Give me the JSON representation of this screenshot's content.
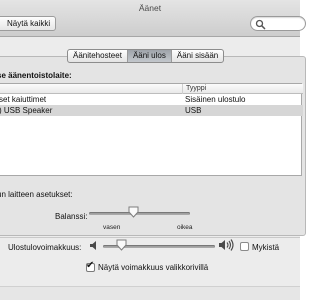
{
  "window": {
    "title": "Äänet"
  },
  "toolbar": {
    "show_all_label": "Näytä kaikki",
    "search_placeholder": ""
  },
  "tabs": [
    {
      "label": "Äänitehosteet",
      "active": false
    },
    {
      "label": "Ääni ulos",
      "active": true
    },
    {
      "label": "Ääni sisään",
      "active": false
    }
  ],
  "output": {
    "section_title": "se äänentoistolaite:",
    "table": {
      "columns": [
        "",
        "Tyyppi"
      ],
      "rows": [
        {
          "name": "set kaiuttimet",
          "type": "Sisäinen ulostulo",
          "selected": false
        },
        {
          "name": ") USB Speaker",
          "type": "USB",
          "selected": true
        }
      ]
    }
  },
  "device_settings": {
    "title": "un laitteen asetukset:",
    "balance_label": "Balanssi:",
    "balance_left": "vasen",
    "balance_right": "oikea",
    "balance_value": 0.5
  },
  "volume": {
    "label": "Ulostulovoimakkuus:",
    "level": 0.15,
    "mute_label": "Mykistä",
    "mute_checked": false,
    "show_in_menubar_label": "Näytä voimakkuus valikkorivillä",
    "show_in_menubar_checked": true
  }
}
